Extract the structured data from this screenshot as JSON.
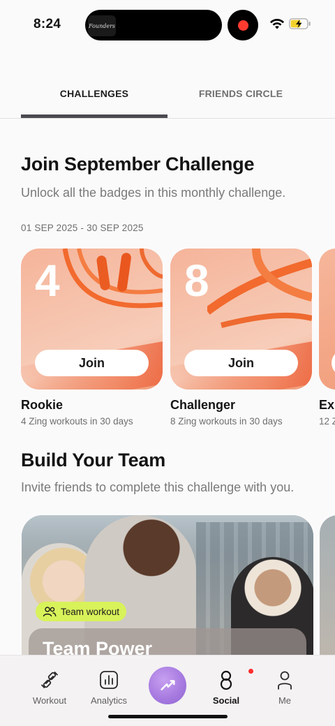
{
  "status_bar": {
    "time": "8:24",
    "island_label": "Founders"
  },
  "tabs": [
    {
      "label": "CHALLENGES",
      "active": true
    },
    {
      "label": "FRIENDS CIRCLE",
      "active": false
    }
  ],
  "september": {
    "title": "Join September Challenge",
    "subtitle": "Unlock all the badges in this monthly challenge.",
    "date_range": "01 SEP 2025 - 30 SEP 2025",
    "cards": [
      {
        "number": "4",
        "button": "Join",
        "name": "Rookie",
        "desc": "4 Zing workouts in 30 days"
      },
      {
        "number": "8",
        "button": "Join",
        "name": "Challenger",
        "desc": "8 Zing workouts in 30 days"
      },
      {
        "number": "",
        "button": "",
        "name": "Exp",
        "desc": "12 Z"
      }
    ]
  },
  "team": {
    "title": "Build Your Team",
    "subtitle": "Invite friends to complete this challenge with you.",
    "card": {
      "badge": "Team workout",
      "title": "Team Power"
    }
  },
  "nav": {
    "items": [
      {
        "label": "Workout",
        "icon": "dumbbell-icon",
        "active": false
      },
      {
        "label": "Analytics",
        "icon": "chart-icon",
        "active": false
      },
      {
        "label": "",
        "icon": "lightning-icon",
        "active": false
      },
      {
        "label": "Social",
        "icon": "social-icon",
        "active": true
      },
      {
        "label": "Me",
        "icon": "person-icon",
        "active": false
      }
    ]
  },
  "colors": {
    "accent_purple": "#a77be0",
    "badge_green": "#d8f25a",
    "card_orange": "#f5b49a",
    "notification_red": "#ff2d2d"
  }
}
